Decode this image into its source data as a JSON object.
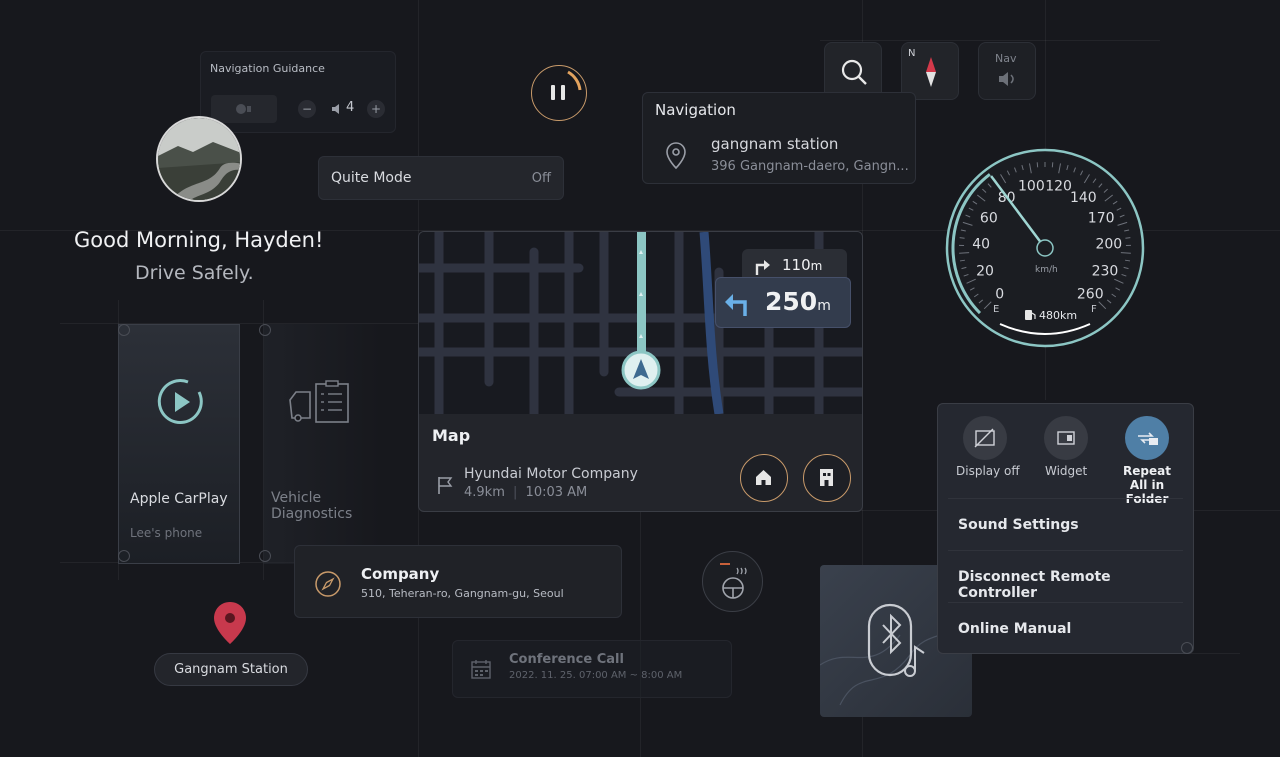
{
  "nav_guidance": {
    "title": "Navigation Guidance",
    "volume": "4",
    "minus": "−",
    "plus": "+"
  },
  "quiet_mode": {
    "label": "Quite Mode",
    "value": "Off"
  },
  "greeting": {
    "line1": "Good Morning, Hayden!",
    "line2": "Drive Safely."
  },
  "navigation_card": {
    "title": "Navigation",
    "place": "gangnam station",
    "address": "396 Gangnam-daero, Gangn..."
  },
  "top_icons": {
    "compass_letter": "N",
    "nav_label": "Nav"
  },
  "map": {
    "title": "Map",
    "destination": "Hyundai Motor Company",
    "distance": "4.9km",
    "separator": "|",
    "eta": "10:03 AM",
    "turn_next": {
      "distance": "110",
      "unit": "m"
    },
    "turn_main": {
      "distance": "250",
      "unit": "m"
    }
  },
  "speedometer": {
    "ticks": [
      "0",
      "20",
      "40",
      "60",
      "80",
      "100",
      "120",
      "140",
      "170",
      "200",
      "230",
      "260"
    ],
    "unit": "km/h",
    "range": "480km",
    "fuel_e": "E",
    "fuel_f": "F",
    "speed_value": 80,
    "speed_max": 260
  },
  "apps": [
    {
      "label": "Apple CarPlay",
      "sub": "Lee's phone"
    },
    {
      "label": "Vehicle Diagnostics",
      "sub": ""
    }
  ],
  "company_card": {
    "title": "Company",
    "address": "510, Teheran-ro, Gangnam-gu, Seoul"
  },
  "location_pill": {
    "label": "Gangnam Station"
  },
  "conference": {
    "title": "Conference Call",
    "time": "2022. 11. 25. 07:00 AM ~ 8:00 AM"
  },
  "quick_menu": {
    "toggles": [
      {
        "label": "Display off"
      },
      {
        "label": "Widget"
      },
      {
        "label": "Repeat All in Folder"
      }
    ],
    "items": [
      "Sound Settings",
      "Disconnect Remote Controller",
      "Online Manual"
    ]
  },
  "colors": {
    "accent_teal": "#8cc6c4",
    "accent_gold": "#c89a6a",
    "pin_red": "#c8394d",
    "active_blue": "#4f7fa6"
  }
}
